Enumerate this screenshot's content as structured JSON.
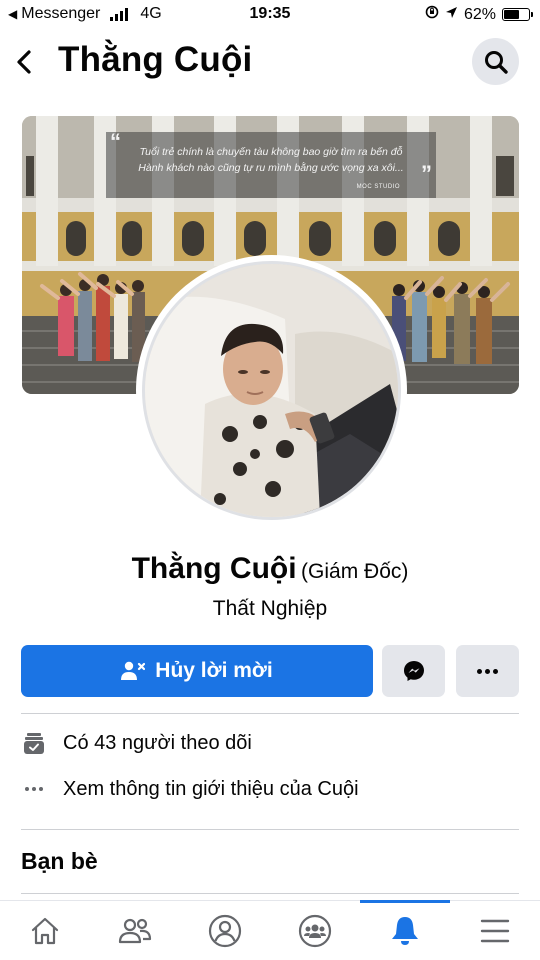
{
  "status_bar": {
    "back_app": "Messenger",
    "network": "4G",
    "time": "19:35",
    "battery_level": "62%",
    "battery_fraction": 0.62
  },
  "header": {
    "title": "Thằng Cuội",
    "back_icon": "chevron-left-icon",
    "search_icon": "search-icon"
  },
  "cover": {
    "quote_line1": "Tuổi trẻ chính là chuyến tàu không bao giờ tìm ra bến đỗ",
    "quote_line2": "Hành khách nào cũng tự ru mình bằng ước vọng xa xôi...",
    "studio": "MOC STUDIO"
  },
  "profile": {
    "name": "Thằng Cuội",
    "nickname": "(Giám Đốc)",
    "subtitle": "Thất Nghiệp"
  },
  "actions": {
    "primary_label": "Hủy lời mời",
    "primary_icon": "user-cancel-icon",
    "message_icon": "messenger-icon",
    "more_icon": "more-icon"
  },
  "info": {
    "followers": "Có 43 người theo dõi",
    "about": "Xem thông tin giới thiệu của Cuội"
  },
  "friends_section": {
    "title": "Bạn bè"
  },
  "bottom_nav": {
    "items": [
      "home-icon",
      "friends-icon",
      "profile-icon",
      "groups-icon",
      "notifications-icon",
      "menu-icon"
    ],
    "active": "notifications-icon"
  },
  "colors": {
    "accent": "#1b74e4",
    "button_gray": "#e4e6eb",
    "text": "#050505",
    "secondary_text": "#65676b"
  }
}
